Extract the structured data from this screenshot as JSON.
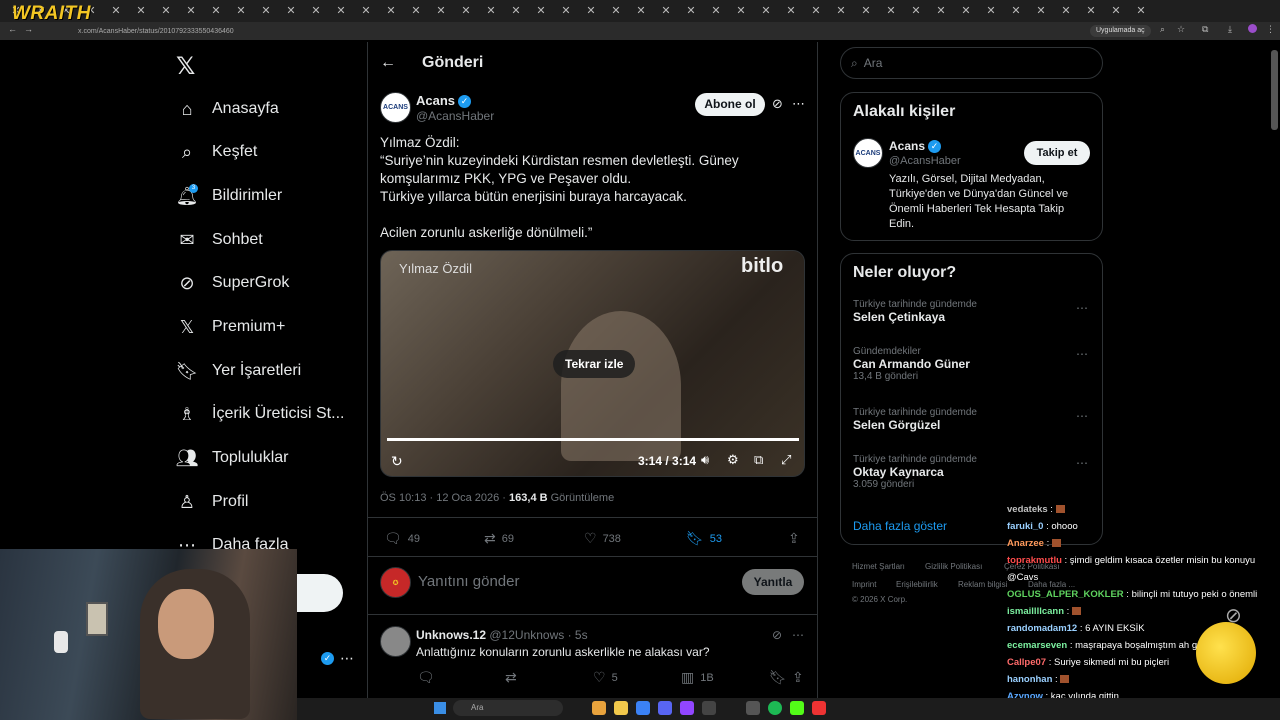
{
  "overlay": {
    "streamer_logo": "WRAITH"
  },
  "browser": {
    "url": "x.com/AcansHaber/status/2010792333550436460",
    "open_in_app": "Uygulamada aç",
    "tab_icon": "X"
  },
  "nav": {
    "items": [
      {
        "label": "Anasayfa",
        "icon": "home-icon"
      },
      {
        "label": "Keşfet",
        "icon": "search-icon"
      },
      {
        "label": "Bildirimler",
        "icon": "bell-icon"
      },
      {
        "label": "Sohbet",
        "icon": "mail-icon"
      },
      {
        "label": "SuperGrok",
        "icon": "grok-icon"
      },
      {
        "label": "Premium+",
        "icon": "x-icon"
      },
      {
        "label": "Yer İşaretleri",
        "icon": "bookmark-icon"
      },
      {
        "label": "İçerik Üreticisi St...",
        "icon": "creator-icon"
      },
      {
        "label": "Topluluklar",
        "icon": "people-icon"
      },
      {
        "label": "Profil",
        "icon": "person-icon"
      },
      {
        "label": "Daha fazla",
        "icon": "more-icon"
      }
    ],
    "notification_count": "3",
    "post_button_fragment": "a"
  },
  "header": {
    "title": "Gönderi"
  },
  "tweet": {
    "author_name": "Acans",
    "author_handle": "@AcansHaber",
    "avatar_text": "ACANS",
    "subscribe_label": "Abone ol",
    "text": "Yılmaz Özdil:\n  “Suriye’nin kuzeyindeki Kürdistan resmen devletleşti.  Güney komşularımız PKK, YPG ve Peşaver oldu.\nTürkiye yıllarca bütün enerjisini buraya harcayacak.\n\nAcilen zorunlu askerliğe dönülmeli.”",
    "video": {
      "overlay_name": "Yılmaz Özdil",
      "brand": "bitlo",
      "replay_label": "Tekrar izle",
      "time": "3:14 / 3:14",
      "progress": 1.0
    },
    "time": "ÖS 10:13 · 12 Oca 2026 · ",
    "views": "163,4 B",
    "views_label": " Görüntüleme",
    "replies": "49",
    "reposts": "69",
    "likes": "738",
    "bookmarks": "53"
  },
  "reply_box": {
    "placeholder": "Yanıtını gönder",
    "button": "Yanıtla"
  },
  "reply": {
    "name": "Unknows.12",
    "handle": "@12Unknows · 5s",
    "text": "Anlattığınız konuların zorunlu askerlikle ne alakası var?",
    "likes": "5",
    "views": "1B"
  },
  "search": {
    "placeholder": "Ara"
  },
  "relevant": {
    "title": "Alakalı kişiler",
    "name": "Acans",
    "handle": "@AcansHaber",
    "follow_label": "Takip et",
    "bio": "Yazılı, Görsel, Dijital Medyadan, Türkiye'den ve Dünya'dan Güncel ve Önemli Haberleri Tek Hesapta Takip Edin."
  },
  "trends": {
    "title": "Neler oluyor?",
    "items": [
      {
        "category": "Türkiye tarihinde gündemde",
        "name": "Selen Çetinkaya",
        "posts": ""
      },
      {
        "category": "Gündemdekiler",
        "name": "Can Armando Güner",
        "posts": "13,4 B gönderi"
      },
      {
        "category": "Türkiye tarihinde gündemde",
        "name": "Selen Görgüzel",
        "posts": ""
      },
      {
        "category": "Türkiye tarihinde gündemde",
        "name": "Oktay Kaynarca",
        "posts": "3.059 gönderi"
      }
    ],
    "show_more": "Daha fazla göster"
  },
  "footer": {
    "links": [
      "Hizmet Şartları",
      "Gizlilik Politikası",
      "Çerez Politikası",
      "Imprint",
      "Erişilebilirlik",
      "Reklam bilgisi",
      "Daha fazla ..."
    ],
    "copyright": "© 2026 X Corp."
  },
  "chat": [
    {
      "user": "vedateks",
      "msg": " : ",
      "color": "#c0c0c0"
    },
    {
      "user": "faruki_0",
      "msg": " : ohooo",
      "color": "#9ad0ff"
    },
    {
      "user": "Anarzee",
      "msg": " : ",
      "color": "#ff9a5c"
    },
    {
      "user": "toprakmutlu",
      "msg": " : şimdi geldim kısaca özetler misin bu konuyu",
      "color": "#ff4d4d"
    },
    {
      "user": "",
      "msg": "@Cavs",
      "color": "#ffffff"
    },
    {
      "user": "OGLUS_ALPER_KOKLER",
      "msg": " : bilinçli mi tutuyo peki o önemli",
      "color": "#5fd35f"
    },
    {
      "user": "ismaillllcann",
      "msg": " : ",
      "color": "#7cf0a0"
    },
    {
      "user": "randomadam12",
      "msg": " : 6 AYIN EKSİK",
      "color": "#9ad0ff"
    },
    {
      "user": "ecemarseven",
      "msg": " : maşrapaya boşalmıştım ah günler",
      "color": "#7cf0a0"
    },
    {
      "user": "Callpe07",
      "msg": " : Suriye sikmedi mi bu piçleri",
      "color": "#ff6a6a"
    },
    {
      "user": "hanonhan",
      "msg": " : ",
      "color": "#9ad0ff"
    },
    {
      "user": "Azynow",
      "msg": " : kaç yılında gittin",
      "color": "#5aa8ff"
    },
    {
      "user": "ivasskangali58",
      "msg": " : ",
      "color": "#ff7ad9"
    }
  ],
  "taskbar": {
    "search_placeholder": "Ara"
  }
}
